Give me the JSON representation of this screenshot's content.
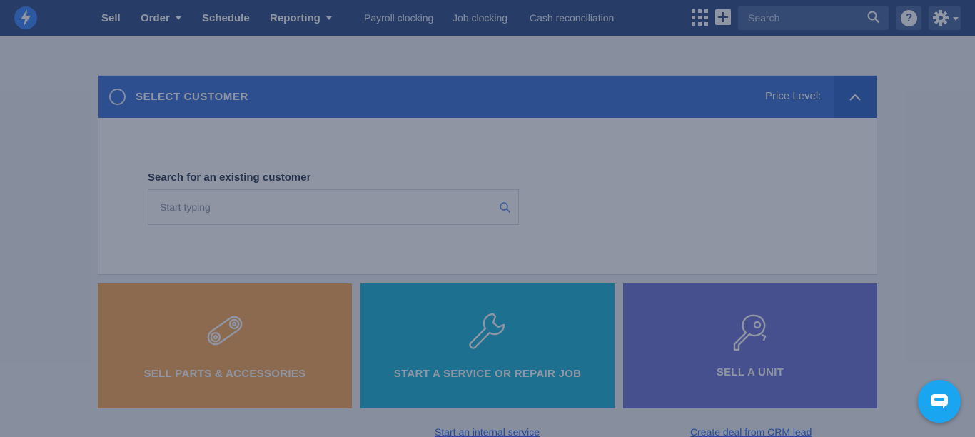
{
  "nav": {
    "logo_icon": "bolt-logo-icon",
    "main_items": [
      {
        "label": "Sell",
        "has_caret": false
      },
      {
        "label": "Order",
        "has_caret": true
      },
      {
        "label": "Schedule",
        "has_caret": false
      },
      {
        "label": "Reporting",
        "has_caret": true
      }
    ],
    "sub_items": [
      {
        "label": "Payroll clocking"
      },
      {
        "label": "Job clocking"
      },
      {
        "label": "Cash reconciliation"
      }
    ],
    "search_placeholder": "Search",
    "help_label": "?",
    "icons": [
      "apps-grid-icon",
      "plus-icon",
      "search-icon",
      "help-icon",
      "gear-icon"
    ]
  },
  "customer": {
    "title": "SELECT CUSTOMER",
    "price_level_label": "Price Level:",
    "search_label": "Search for an existing customer",
    "search_placeholder": "Start typing",
    "icons": [
      "person-icon",
      "chevron-up-icon",
      "search-icon"
    ]
  },
  "actions": [
    {
      "label": "SELL PARTS & ACCESSORIES",
      "color": "#f7a95b",
      "icon": "chain-link-icon"
    },
    {
      "label": "START A SERVICE OR REPAIR JOB",
      "color": "#1cb4dc",
      "icon": "wrench-icon"
    },
    {
      "label": "SELL A UNIT",
      "color": "#6f75d8",
      "icon": "key-icon"
    }
  ],
  "links": {
    "internal_service": "Start an internal service",
    "crm_deal": "Create deal from CRM lead"
  },
  "chat": {
    "icon": "chat-bubble-icon"
  },
  "colors": {
    "nav_bg": "#2f4e88",
    "panel_header": "#3a73d9",
    "link": "#2f6bf0",
    "chat": "#1aa5f0"
  }
}
